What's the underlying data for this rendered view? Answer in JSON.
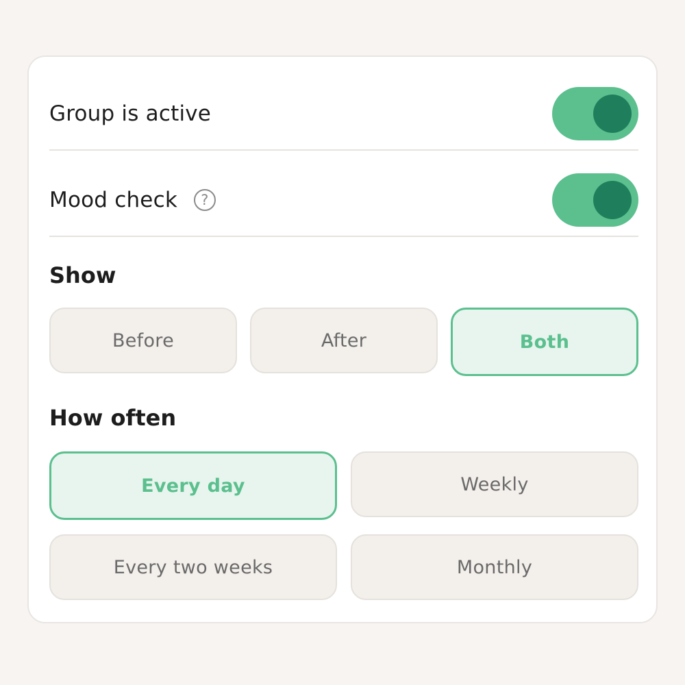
{
  "settings": {
    "group_active": {
      "label": "Group is active",
      "on": true
    },
    "mood_check": {
      "label": "Mood check",
      "help_glyph": "?",
      "help_icon": "question-circle-icon",
      "on": true
    }
  },
  "show": {
    "title": "Show",
    "options": [
      "Before",
      "After",
      "Both"
    ],
    "selected": "Both"
  },
  "how_often": {
    "title": "How often",
    "options": [
      "Every day",
      "Weekly",
      "Every two weeks",
      "Monthly"
    ],
    "selected": "Every day"
  },
  "colors": {
    "accent": "#5bbf8e",
    "accent_dark": "#1f7f5c",
    "selected_bg": "#e7f5ee",
    "option_bg": "#f3efeb",
    "page_bg": "#f8f4f1"
  }
}
